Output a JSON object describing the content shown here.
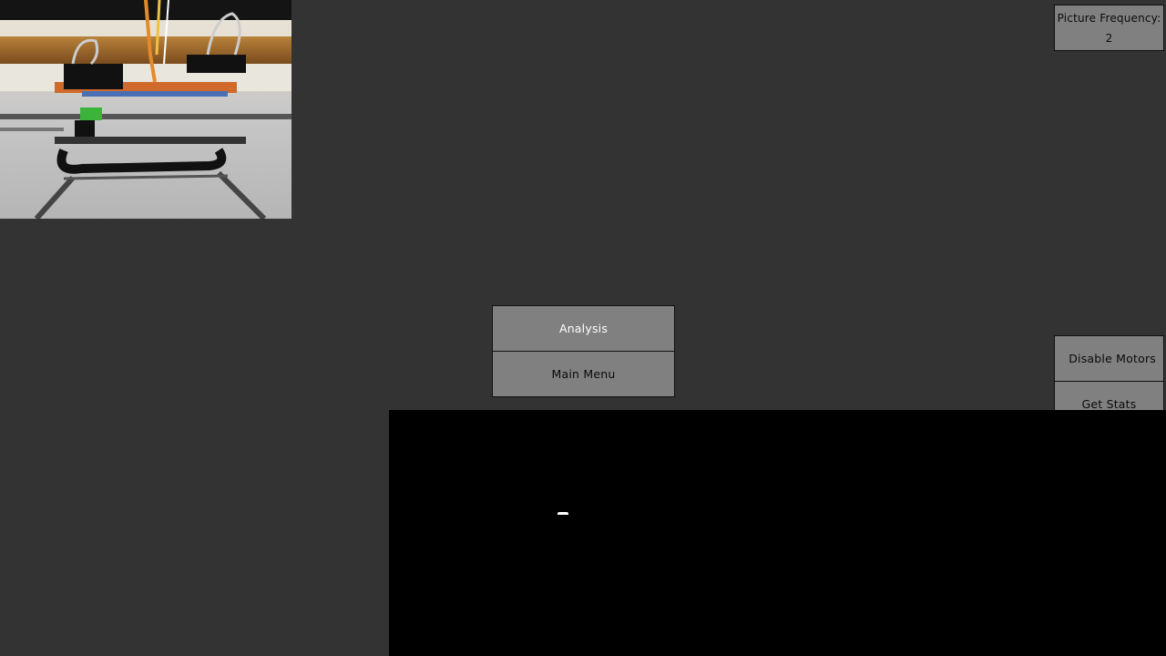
{
  "camera": {
    "icon": "camera-feed-image"
  },
  "controls": {
    "picture_frequency_label": "Picture Frequency:",
    "picture_frequency_value": "2",
    "analysis_label": "Analysis",
    "main_menu_label": "Main Menu",
    "disable_motors_label": "Disable Motors",
    "get_stats_label": "Get Stats"
  },
  "colors": {
    "background": "#333333",
    "button": "#808080",
    "canvas": "#000000"
  }
}
